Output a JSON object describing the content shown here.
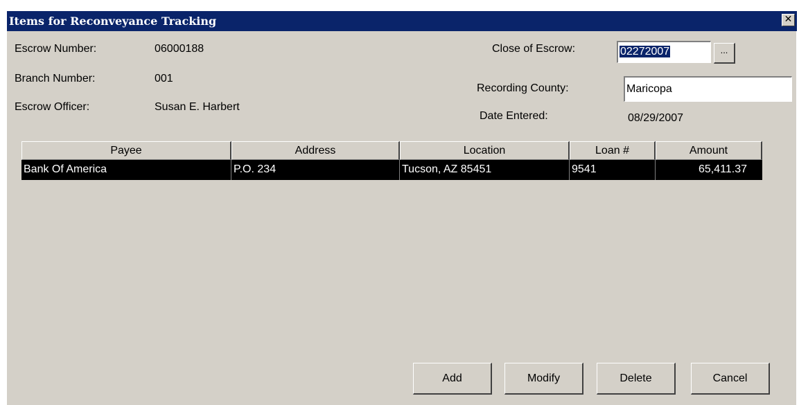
{
  "window": {
    "title": "Items for Reconveyance Tracking",
    "close_glyph": "✕"
  },
  "fields": {
    "escrow_number": {
      "label": "Escrow Number:",
      "value": "06000188"
    },
    "branch_number": {
      "label": "Branch Number:",
      "value": "001"
    },
    "escrow_officer": {
      "label": "Escrow Officer:",
      "value": "Susan E. Harbert"
    },
    "close_of_escrow": {
      "label": "Close of Escrow:",
      "value": "02272007",
      "button": "..."
    },
    "recording_county": {
      "label": "Recording County:",
      "value": "Maricopa"
    },
    "date_entered": {
      "label": "Date Entered:",
      "value": "08/29/2007"
    }
  },
  "table": {
    "columns": [
      "Payee",
      "Address",
      "Location",
      "Loan #",
      "Amount"
    ],
    "rows": [
      [
        "Bank Of America",
        "P.O. 234",
        "Tucson, AZ  85451",
        "9541",
        "65,411.37"
      ]
    ]
  },
  "buttons": {
    "add": {
      "mnemonic": "A",
      "rest": "dd"
    },
    "modify": {
      "mnemonic": "M",
      "rest": "odify"
    },
    "delete": {
      "mnemonic": "D",
      "rest": "elete"
    },
    "cancel": {
      "mnemonic": "C",
      "rest": "ancel"
    }
  }
}
